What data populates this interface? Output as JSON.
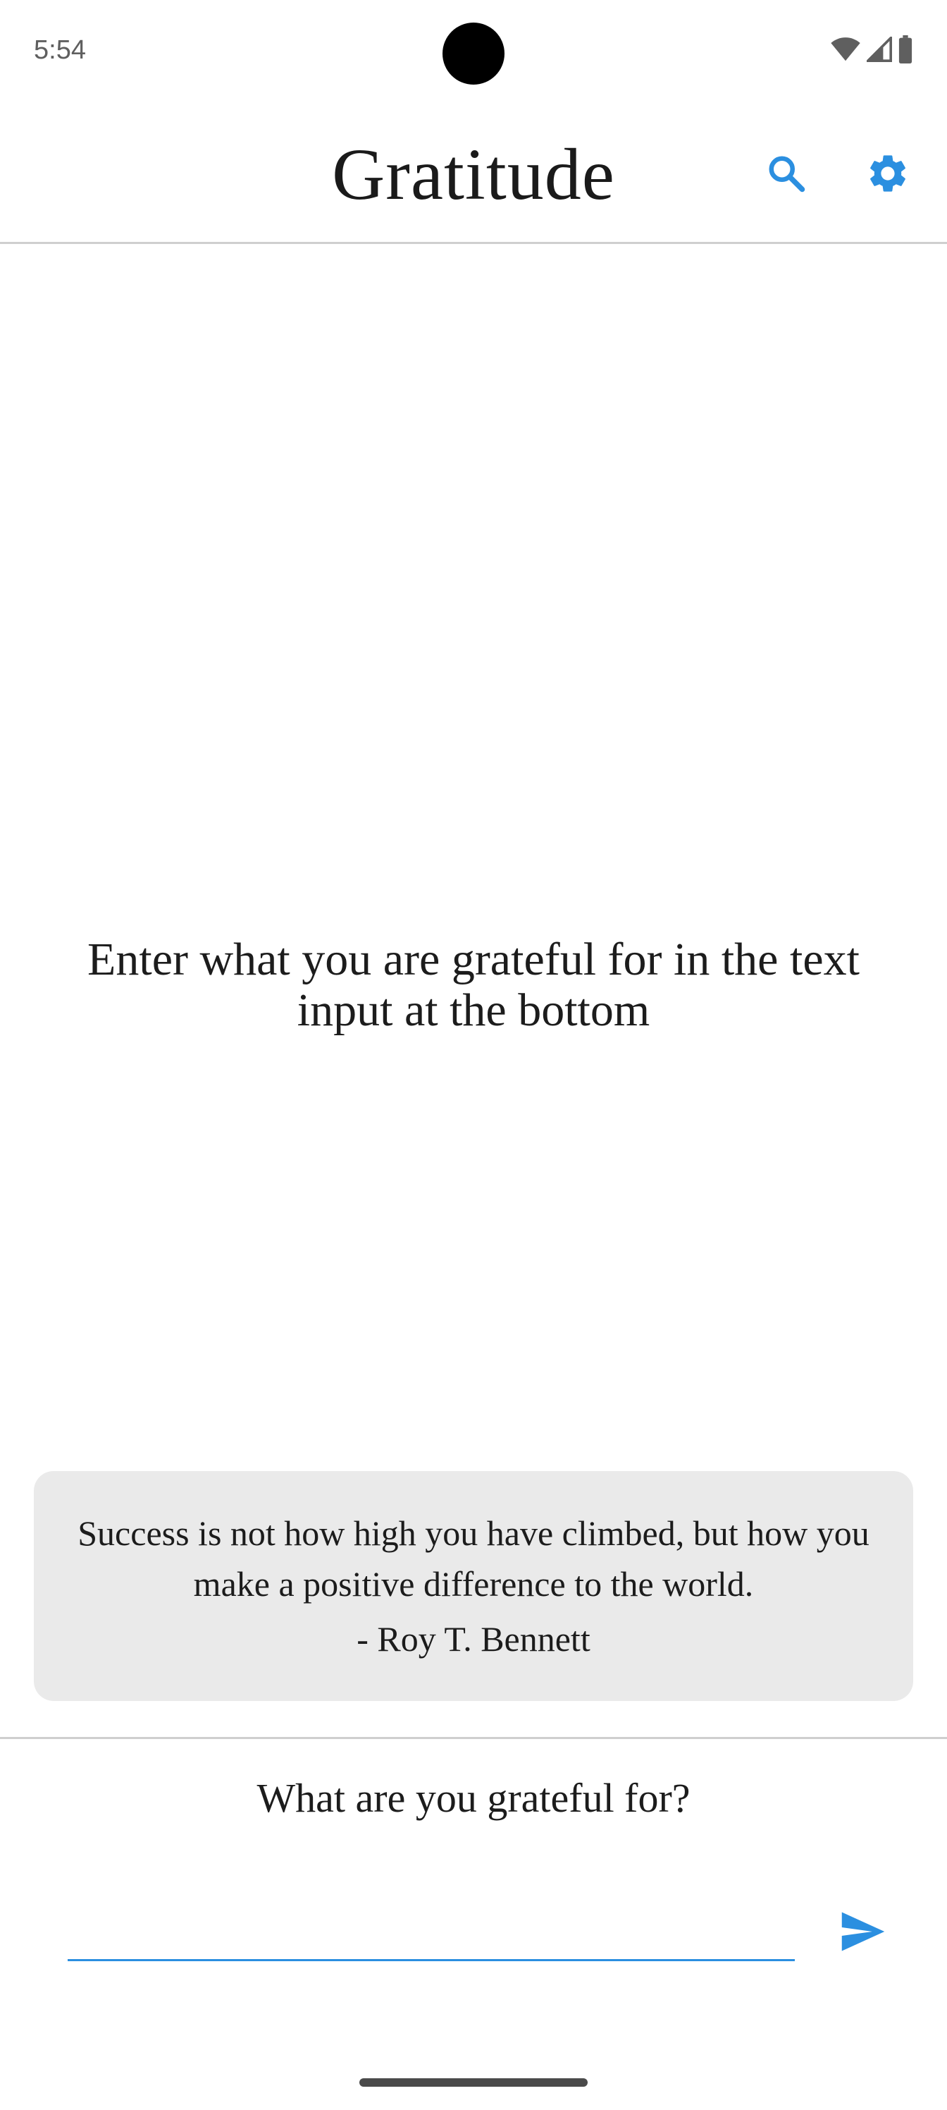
{
  "status_bar": {
    "time": "5:54",
    "icons": [
      "wifi-icon",
      "cellular-signal-icon",
      "battery-icon"
    ]
  },
  "app_bar": {
    "title": "Gratitude",
    "actions": [
      "search-icon",
      "gear-icon"
    ]
  },
  "empty_state": {
    "message": "Enter what you are grateful for in the text input at the bottom"
  },
  "quote": {
    "text": "Success is not how high you have climbed, but how you make a positive difference to the world.",
    "author": "- Roy T. Bennett"
  },
  "entry": {
    "prompt": "What are you grateful for?",
    "value": "",
    "placeholder": ""
  },
  "colors": {
    "accent": "#2b8fe0",
    "card_background": "#eaeaea",
    "divider": "#cfcfcf"
  }
}
